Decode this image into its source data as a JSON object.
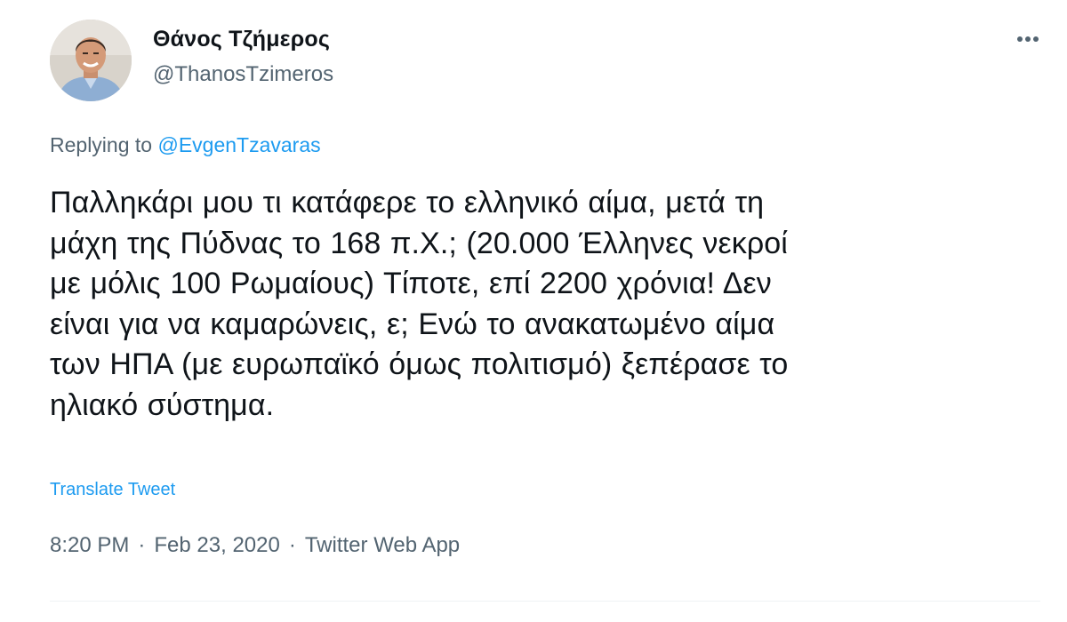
{
  "author": {
    "display_name": "Θάνος Τζήμερος",
    "handle": "@ThanosTzimeros",
    "avatar": "profile-photo"
  },
  "reply": {
    "prefix": "Replying to",
    "to_handle": "@EvgenTzavaras"
  },
  "tweet": {
    "lines": [
      "Παλληκάρι μου τι κατάφερε το ελληνικό αίμα, μετά τη",
      "μάχη της Πύδνας το 168 π.Χ.; (20.000 Έλληνες νεκροί",
      "με μόλις 100 Ρωμαίους) Τίποτε, επί 2200 χρόνια! Δεν",
      "είναι για να καμαρώνεις, ε; Ενώ το ανακατωμένο αίμα",
      "των ΗΠΑ (με ευρωπαϊκό όμως πολιτισμό) ξεπέρασε το",
      "ηλιακό σύστημα."
    ],
    "translate_label": "Translate Tweet"
  },
  "meta": {
    "time": "8:20 PM",
    "separator": "·",
    "date": "Feb 23, 2020",
    "source": "Twitter Web App"
  },
  "icons": {
    "more": "more-options-icon"
  },
  "colors": {
    "link": "#1d9bf0",
    "secondary_text": "#536471",
    "primary_text": "#0f1419"
  }
}
